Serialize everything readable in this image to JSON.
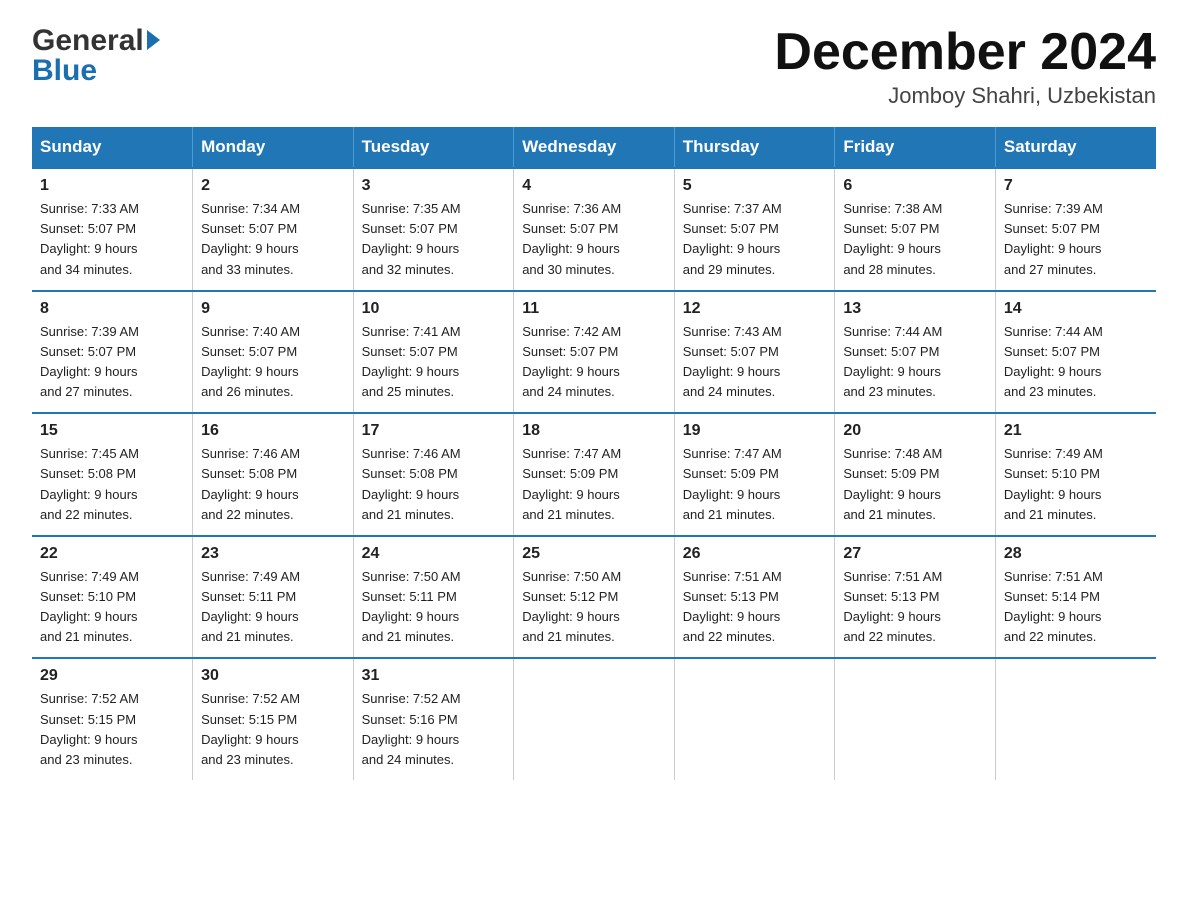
{
  "header": {
    "logo_line1": "General",
    "logo_line2": "Blue",
    "title": "December 2024",
    "subtitle": "Jomboy Shahri, Uzbekistan"
  },
  "days_of_week": [
    "Sunday",
    "Monday",
    "Tuesday",
    "Wednesday",
    "Thursday",
    "Friday",
    "Saturday"
  ],
  "weeks": [
    [
      {
        "day": "1",
        "sunrise": "7:33 AM",
        "sunset": "5:07 PM",
        "daylight": "9 hours and 34 minutes."
      },
      {
        "day": "2",
        "sunrise": "7:34 AM",
        "sunset": "5:07 PM",
        "daylight": "9 hours and 33 minutes."
      },
      {
        "day": "3",
        "sunrise": "7:35 AM",
        "sunset": "5:07 PM",
        "daylight": "9 hours and 32 minutes."
      },
      {
        "day": "4",
        "sunrise": "7:36 AM",
        "sunset": "5:07 PM",
        "daylight": "9 hours and 30 minutes."
      },
      {
        "day": "5",
        "sunrise": "7:37 AM",
        "sunset": "5:07 PM",
        "daylight": "9 hours and 29 minutes."
      },
      {
        "day": "6",
        "sunrise": "7:38 AM",
        "sunset": "5:07 PM",
        "daylight": "9 hours and 28 minutes."
      },
      {
        "day": "7",
        "sunrise": "7:39 AM",
        "sunset": "5:07 PM",
        "daylight": "9 hours and 27 minutes."
      }
    ],
    [
      {
        "day": "8",
        "sunrise": "7:39 AM",
        "sunset": "5:07 PM",
        "daylight": "9 hours and 27 minutes."
      },
      {
        "day": "9",
        "sunrise": "7:40 AM",
        "sunset": "5:07 PM",
        "daylight": "9 hours and 26 minutes."
      },
      {
        "day": "10",
        "sunrise": "7:41 AM",
        "sunset": "5:07 PM",
        "daylight": "9 hours and 25 minutes."
      },
      {
        "day": "11",
        "sunrise": "7:42 AM",
        "sunset": "5:07 PM",
        "daylight": "9 hours and 24 minutes."
      },
      {
        "day": "12",
        "sunrise": "7:43 AM",
        "sunset": "5:07 PM",
        "daylight": "9 hours and 24 minutes."
      },
      {
        "day": "13",
        "sunrise": "7:44 AM",
        "sunset": "5:07 PM",
        "daylight": "9 hours and 23 minutes."
      },
      {
        "day": "14",
        "sunrise": "7:44 AM",
        "sunset": "5:07 PM",
        "daylight": "9 hours and 23 minutes."
      }
    ],
    [
      {
        "day": "15",
        "sunrise": "7:45 AM",
        "sunset": "5:08 PM",
        "daylight": "9 hours and 22 minutes."
      },
      {
        "day": "16",
        "sunrise": "7:46 AM",
        "sunset": "5:08 PM",
        "daylight": "9 hours and 22 minutes."
      },
      {
        "day": "17",
        "sunrise": "7:46 AM",
        "sunset": "5:08 PM",
        "daylight": "9 hours and 21 minutes."
      },
      {
        "day": "18",
        "sunrise": "7:47 AM",
        "sunset": "5:09 PM",
        "daylight": "9 hours and 21 minutes."
      },
      {
        "day": "19",
        "sunrise": "7:47 AM",
        "sunset": "5:09 PM",
        "daylight": "9 hours and 21 minutes."
      },
      {
        "day": "20",
        "sunrise": "7:48 AM",
        "sunset": "5:09 PM",
        "daylight": "9 hours and 21 minutes."
      },
      {
        "day": "21",
        "sunrise": "7:49 AM",
        "sunset": "5:10 PM",
        "daylight": "9 hours and 21 minutes."
      }
    ],
    [
      {
        "day": "22",
        "sunrise": "7:49 AM",
        "sunset": "5:10 PM",
        "daylight": "9 hours and 21 minutes."
      },
      {
        "day": "23",
        "sunrise": "7:49 AM",
        "sunset": "5:11 PM",
        "daylight": "9 hours and 21 minutes."
      },
      {
        "day": "24",
        "sunrise": "7:50 AM",
        "sunset": "5:11 PM",
        "daylight": "9 hours and 21 minutes."
      },
      {
        "day": "25",
        "sunrise": "7:50 AM",
        "sunset": "5:12 PM",
        "daylight": "9 hours and 21 minutes."
      },
      {
        "day": "26",
        "sunrise": "7:51 AM",
        "sunset": "5:13 PM",
        "daylight": "9 hours and 22 minutes."
      },
      {
        "day": "27",
        "sunrise": "7:51 AM",
        "sunset": "5:13 PM",
        "daylight": "9 hours and 22 minutes."
      },
      {
        "day": "28",
        "sunrise": "7:51 AM",
        "sunset": "5:14 PM",
        "daylight": "9 hours and 22 minutes."
      }
    ],
    [
      {
        "day": "29",
        "sunrise": "7:52 AM",
        "sunset": "5:15 PM",
        "daylight": "9 hours and 23 minutes."
      },
      {
        "day": "30",
        "sunrise": "7:52 AM",
        "sunset": "5:15 PM",
        "daylight": "9 hours and 23 minutes."
      },
      {
        "day": "31",
        "sunrise": "7:52 AM",
        "sunset": "5:16 PM",
        "daylight": "9 hours and 24 minutes."
      },
      null,
      null,
      null,
      null
    ]
  ],
  "labels": {
    "sunrise": "Sunrise:",
    "sunset": "Sunset:",
    "daylight": "Daylight:"
  }
}
